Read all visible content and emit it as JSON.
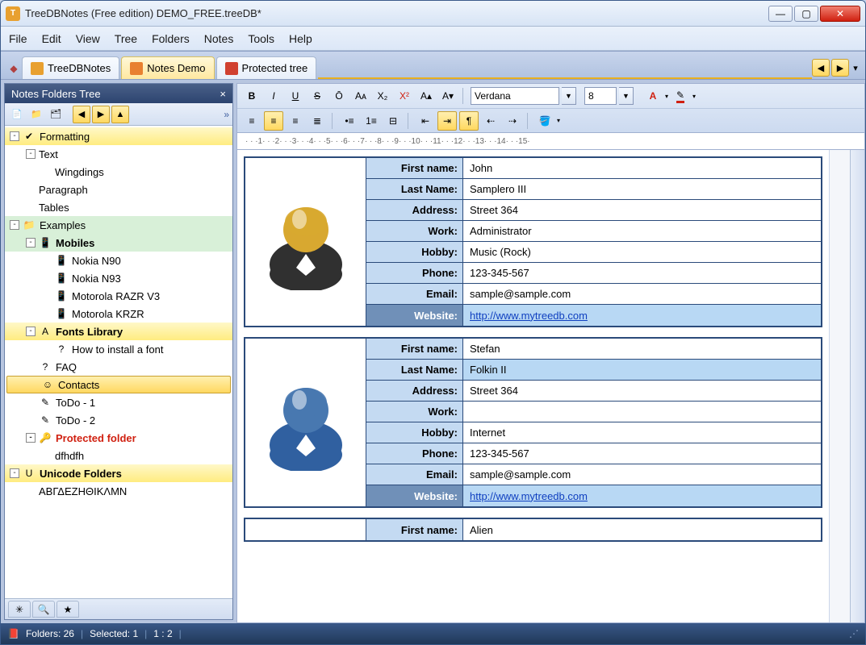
{
  "window": {
    "title": "TreeDBNotes (Free edition) DEMO_FREE.treeDB*"
  },
  "menu": [
    "File",
    "Edit",
    "View",
    "Tree",
    "Folders",
    "Notes",
    "Tools",
    "Help"
  ],
  "tabs": [
    {
      "label": "TreeDBNotes",
      "active": false
    },
    {
      "label": "Notes Demo",
      "active": true
    },
    {
      "label": "Protected tree",
      "active": false
    }
  ],
  "sidebar": {
    "title": "Notes Folders Tree",
    "tree": [
      {
        "indent": 0,
        "exp": "-",
        "icon": "✔",
        "lbl": "Formatting",
        "cls": "hl-yellow"
      },
      {
        "indent": 1,
        "exp": "-",
        "icon": "",
        "lbl": "Text",
        "cls": ""
      },
      {
        "indent": 2,
        "exp": "",
        "icon": "",
        "lbl": "Wingdings",
        "cls": ""
      },
      {
        "indent": 1,
        "exp": "",
        "icon": "",
        "lbl": "Paragraph",
        "cls": ""
      },
      {
        "indent": 1,
        "exp": "",
        "icon": "",
        "lbl": "Tables",
        "cls": ""
      },
      {
        "indent": 0,
        "exp": "-",
        "icon": "📁",
        "lbl": "Examples",
        "cls": "hl-green"
      },
      {
        "indent": 1,
        "exp": "-",
        "icon": "📱",
        "lbl": "Mobiles",
        "cls": "hl-green bold"
      },
      {
        "indent": 2,
        "exp": "",
        "icon": "📱",
        "lbl": "Nokia N90",
        "cls": ""
      },
      {
        "indent": 2,
        "exp": "",
        "icon": "📱",
        "lbl": "Nokia N93",
        "cls": ""
      },
      {
        "indent": 2,
        "exp": "",
        "icon": "📱",
        "lbl": "Motorola RAZR V3",
        "cls": ""
      },
      {
        "indent": 2,
        "exp": "",
        "icon": "📱",
        "lbl": "Motorola KRZR",
        "cls": ""
      },
      {
        "indent": 1,
        "exp": "-",
        "icon": "A",
        "lbl": "Fonts Library",
        "cls": "hl-yellow bold"
      },
      {
        "indent": 2,
        "exp": "",
        "icon": "?",
        "lbl": "How to install a font",
        "cls": ""
      },
      {
        "indent": 1,
        "exp": "",
        "icon": "?",
        "lbl": "FAQ",
        "cls": ""
      },
      {
        "indent": 1,
        "exp": "",
        "icon": "☺",
        "lbl": "Contacts",
        "cls": "hl-sel"
      },
      {
        "indent": 1,
        "exp": "",
        "icon": "✎",
        "lbl": "ToDo - 1",
        "cls": ""
      },
      {
        "indent": 1,
        "exp": "",
        "icon": "✎",
        "lbl": "ToDo - 2",
        "cls": ""
      },
      {
        "indent": 1,
        "exp": "-",
        "icon": "🔑",
        "lbl": "Protected folder",
        "cls": "red"
      },
      {
        "indent": 2,
        "exp": "",
        "icon": "",
        "lbl": "dfhdfh",
        "cls": ""
      },
      {
        "indent": 0,
        "exp": "-",
        "icon": "U",
        "lbl": "Unicode Folders",
        "cls": "hl-yellow bold"
      },
      {
        "indent": 1,
        "exp": "",
        "icon": "",
        "lbl": "ΑΒΓΔΕΖΗΘΙΚΛΜΝ",
        "cls": ""
      }
    ]
  },
  "editor": {
    "font": "Verdana",
    "fontSize": "8"
  },
  "contacts": [
    {
      "avatar": "gold",
      "fields": [
        [
          "First name:",
          "John",
          false
        ],
        [
          "Last Name:",
          "Samplero III",
          false
        ],
        [
          "Address:",
          "Street 364",
          false
        ],
        [
          "Work:",
          "Administrator",
          false
        ],
        [
          "Hobby:",
          "Music (Rock)",
          false
        ],
        [
          "Phone:",
          "123-345-567",
          false
        ],
        [
          "Email:",
          "sample@sample.com",
          false
        ],
        [
          "Website:",
          "http://www.mytreedb.com",
          true
        ]
      ]
    },
    {
      "avatar": "blue",
      "fields": [
        [
          "First name:",
          "Stefan",
          false
        ],
        [
          "Last Name:",
          "Folkin II",
          false
        ],
        [
          "Address:",
          "Street 364",
          false
        ],
        [
          "Work:",
          "",
          false
        ],
        [
          "Hobby:",
          "Internet",
          false
        ],
        [
          "Phone:",
          "123-345-567",
          false
        ],
        [
          "Email:",
          "sample@sample.com",
          false
        ],
        [
          "Website:",
          "http://www.mytreedb.com",
          true
        ]
      ]
    },
    {
      "avatar": "",
      "fields": [
        [
          "First name:",
          "Alien",
          false
        ]
      ]
    }
  ],
  "status": {
    "folders": "Folders: 26",
    "selected": "Selected: 1",
    "pos": "1 : 2"
  }
}
